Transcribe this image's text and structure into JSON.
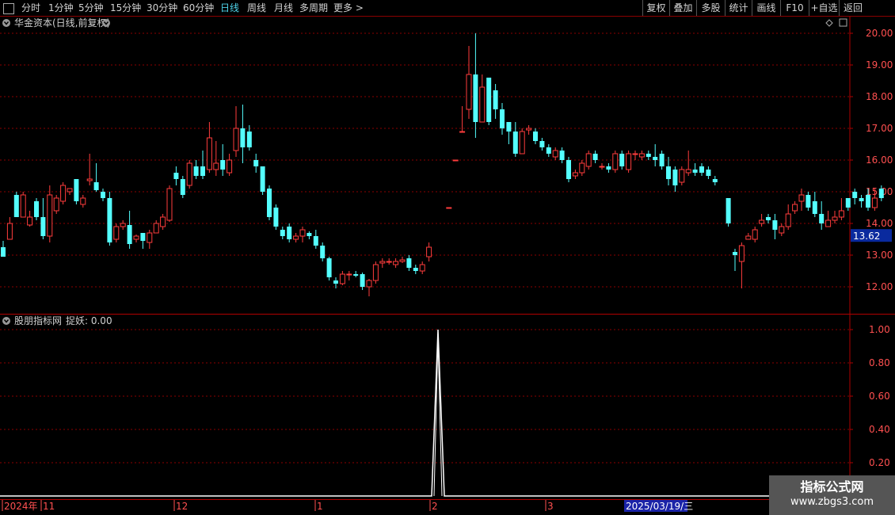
{
  "toolbar": {
    "left_items": [
      "分时",
      "1分钟",
      "5分钟",
      "15分钟",
      "30分钟",
      "60分钟",
      "日线",
      "周线",
      "月线",
      "多周期",
      "更多 >"
    ],
    "active": "日线",
    "right_items": [
      "复权",
      "叠加",
      "多股",
      "统计",
      "画线",
      "F10",
      "+自选",
      "返回"
    ]
  },
  "main_panel": {
    "title": "华金资本(日线,前复权)",
    "y_labels": [
      "20.00",
      "19.00",
      "18.00",
      "17.00",
      "16.00",
      "15.00",
      "14.00",
      "13.00",
      "12.00"
    ],
    "current_price": "13.62"
  },
  "indicator_panel": {
    "title": "股朋指标网",
    "indicator_label": "捉妖: 0.00",
    "y_labels": [
      "1.00",
      "0.80",
      "0.60",
      "0.40",
      "0.20"
    ],
    "spike": {
      "x_date": "2025-02",
      "value": 1.0
    }
  },
  "time_axis": {
    "labels": [
      "2024年",
      "11",
      "12",
      "1",
      "2",
      "3"
    ],
    "cursor_date": "2025/03/19/三"
  },
  "watermark": {
    "title": "指标公式网",
    "url": "www.zbgs3.com"
  },
  "colors": {
    "up": "#ff3d3d",
    "down": "#54ffff",
    "grid": "#8b0000",
    "axis_text": "#ff5050",
    "indicator_line": "#ffffff"
  },
  "chart_data": {
    "type": "candlestick",
    "ylim": [
      11.6,
      20.1
    ],
    "candles": [
      [
        13.25,
        12.95,
        13.45,
        12.95
      ],
      [
        13.5,
        14.0,
        13.6,
        14.2
      ],
      [
        14.9,
        14.2,
        14.3,
        15.0
      ],
      [
        14.2,
        14.9,
        14.2,
        15.0
      ],
      [
        13.95,
        14.2,
        13.9,
        14.4
      ],
      [
        14.7,
        14.2,
        14.1,
        14.8
      ],
      [
        14.2,
        13.6,
        13.5,
        14.8
      ],
      [
        13.6,
        14.9,
        13.4,
        15.2
      ],
      [
        14.4,
        14.8,
        14.3,
        14.9
      ],
      [
        14.7,
        15.2,
        14.6,
        15.3
      ],
      [
        15.0,
        15.1,
        14.9,
        15.1
      ],
      [
        15.4,
        14.7,
        14.6,
        15.4
      ],
      [
        14.6,
        14.8,
        14.5,
        14.9
      ],
      [
        15.35,
        15.4,
        15.2,
        16.2
      ],
      [
        15.3,
        15.05,
        15.0,
        15.9
      ],
      [
        15.0,
        14.8,
        14.7,
        15.1
      ],
      [
        14.8,
        13.4,
        13.3,
        15.0
      ],
      [
        13.5,
        13.9,
        13.4,
        14.0
      ],
      [
        13.9,
        14.0,
        13.8,
        14.1
      ],
      [
        13.95,
        13.35,
        13.2,
        14.4
      ],
      [
        13.5,
        13.6,
        13.4,
        13.65
      ],
      [
        13.7,
        13.45,
        13.2,
        13.7
      ],
      [
        13.4,
        13.7,
        13.2,
        13.8
      ],
      [
        13.7,
        14.0,
        13.7,
        14.1
      ],
      [
        13.9,
        14.2,
        13.8,
        14.3
      ],
      [
        14.1,
        15.1,
        14.05,
        15.2
      ],
      [
        15.6,
        15.4,
        15.2,
        15.8
      ],
      [
        15.4,
        14.9,
        14.8,
        15.5
      ],
      [
        15.2,
        15.9,
        15.1,
        16.0
      ],
      [
        15.8,
        15.5,
        15.4,
        16.0
      ],
      [
        15.8,
        15.5,
        15.4,
        16.3
      ],
      [
        15.7,
        16.7,
        15.6,
        17.2
      ],
      [
        15.7,
        15.9,
        15.5,
        16.6
      ],
      [
        16.0,
        15.7,
        15.5,
        16.5
      ],
      [
        15.6,
        16.0,
        15.5,
        16.2
      ],
      [
        16.3,
        17.0,
        16.1,
        17.7
      ],
      [
        17.0,
        16.4,
        15.9,
        17.75
      ],
      [
        16.9,
        16.4,
        16.3,
        17.1
      ],
      [
        16.0,
        15.8,
        15.6,
        16.2
      ],
      [
        15.8,
        15.0,
        14.9,
        15.8
      ],
      [
        15.1,
        14.2,
        14.1,
        15.2
      ],
      [
        14.5,
        13.9,
        13.8,
        14.6
      ],
      [
        13.8,
        13.6,
        13.5,
        13.9
      ],
      [
        13.9,
        13.5,
        13.4,
        14.0
      ],
      [
        13.5,
        13.6,
        13.4,
        13.7
      ],
      [
        13.6,
        13.8,
        13.4,
        13.9
      ],
      [
        13.7,
        13.6,
        13.5,
        13.75
      ],
      [
        13.6,
        13.3,
        13.2,
        13.8
      ],
      [
        13.3,
        12.9,
        12.8,
        13.4
      ],
      [
        12.9,
        12.3,
        12.2,
        12.95
      ],
      [
        12.2,
        12.1,
        11.95,
        12.3
      ],
      [
        12.1,
        12.4,
        12.05,
        12.5
      ],
      [
        12.4,
        12.4,
        12.2,
        12.5
      ],
      [
        12.4,
        12.35,
        12.3,
        12.5
      ],
      [
        12.4,
        12.0,
        11.9,
        12.45
      ],
      [
        12.0,
        12.2,
        11.7,
        12.25
      ],
      [
        12.2,
        12.7,
        12.1,
        12.8
      ],
      [
        12.75,
        12.8,
        12.6,
        12.9
      ],
      [
        12.8,
        12.8,
        12.7,
        12.9
      ],
      [
        12.7,
        12.8,
        12.6,
        12.9
      ],
      [
        12.8,
        12.85,
        12.75,
        12.95
      ],
      [
        12.9,
        12.6,
        12.5,
        13.0
      ],
      [
        12.6,
        12.5,
        12.4,
        12.7
      ],
      [
        12.5,
        12.7,
        12.4,
        12.8
      ],
      [
        12.95,
        13.25,
        12.8,
        13.4
      ],
      [
        null,
        null,
        null,
        null
      ],
      [
        null,
        null,
        null,
        null
      ],
      [
        14.5,
        14.5,
        14.5,
        14.5
      ],
      [
        16.0,
        16.0,
        16.0,
        16.0
      ],
      [
        16.9,
        16.9,
        16.9,
        17.7
      ],
      [
        17.6,
        18.7,
        17.3,
        19.6
      ],
      [
        18.7,
        17.2,
        16.7,
        20.0
      ],
      [
        17.2,
        18.3,
        17.2,
        18.7
      ],
      [
        18.6,
        17.2,
        17.1,
        18.6
      ],
      [
        18.2,
        17.6,
        17.3,
        18.4
      ],
      [
        17.6,
        17.0,
        16.8,
        17.8
      ],
      [
        17.2,
        16.9,
        16.5,
        17.2
      ],
      [
        16.9,
        16.2,
        16.1,
        17.2
      ],
      [
        16.2,
        16.9,
        16.2,
        17.0
      ],
      [
        16.95,
        17.0,
        16.8,
        17.1
      ],
      [
        16.9,
        16.6,
        16.5,
        17.0
      ],
      [
        16.6,
        16.4,
        16.3,
        16.7
      ],
      [
        16.4,
        16.2,
        16.1,
        16.5
      ],
      [
        16.1,
        16.3,
        16.0,
        16.4
      ],
      [
        16.3,
        16.0,
        15.9,
        16.4
      ],
      [
        16.0,
        15.4,
        15.3,
        16.1
      ],
      [
        15.5,
        15.6,
        15.4,
        15.7
      ],
      [
        15.6,
        15.9,
        15.5,
        16.0
      ],
      [
        15.8,
        16.2,
        15.7,
        16.3
      ],
      [
        16.2,
        16.0,
        15.9,
        16.3
      ],
      [
        15.8,
        15.8,
        15.7,
        15.9
      ],
      [
        15.8,
        15.7,
        15.6,
        15.9
      ],
      [
        15.7,
        16.2,
        15.6,
        16.3
      ],
      [
        16.2,
        15.8,
        15.7,
        16.3
      ],
      [
        15.7,
        16.2,
        15.6,
        16.3
      ],
      [
        16.2,
        16.2,
        16.0,
        16.3
      ],
      [
        16.1,
        16.2,
        16.0,
        16.3
      ],
      [
        16.2,
        16.1,
        16.0,
        16.3
      ],
      [
        16.1,
        16.0,
        15.8,
        16.5
      ],
      [
        16.2,
        15.8,
        15.7,
        16.3
      ],
      [
        15.8,
        15.4,
        15.2,
        16.1
      ],
      [
        15.7,
        15.2,
        15.0,
        15.8
      ],
      [
        15.3,
        15.7,
        15.2,
        15.8
      ],
      [
        15.6,
        15.7,
        15.5,
        16.3
      ],
      [
        15.7,
        15.6,
        15.5,
        15.9
      ],
      [
        15.8,
        15.6,
        15.5,
        15.9
      ],
      [
        15.7,
        15.5,
        15.4,
        15.8
      ],
      [
        15.4,
        15.3,
        15.2,
        15.5
      ],
      [
        null,
        null,
        null,
        null
      ],
      [
        14.8,
        14.0,
        13.9,
        14.8
      ],
      [
        13.1,
        13.0,
        12.5,
        13.2
      ],
      [
        12.8,
        13.3,
        11.95,
        13.4
      ],
      [
        13.5,
        13.6,
        13.5,
        13.7
      ],
      [
        13.5,
        13.8,
        13.4,
        13.9
      ],
      [
        14.0,
        14.1,
        13.9,
        14.3
      ],
      [
        14.2,
        14.1,
        14.0,
        14.3
      ],
      [
        14.1,
        13.8,
        13.5,
        14.3
      ],
      [
        13.7,
        13.9,
        13.6,
        14.0
      ],
      [
        13.9,
        14.3,
        13.8,
        14.6
      ],
      [
        14.4,
        14.6,
        14.3,
        14.7
      ],
      [
        14.7,
        14.9,
        14.4,
        15.1
      ],
      [
        14.9,
        14.5,
        14.4,
        15.0
      ],
      [
        14.7,
        14.3,
        14.2,
        15.0
      ],
      [
        14.3,
        14.0,
        13.8,
        14.7
      ],
      [
        13.9,
        14.1,
        13.9,
        14.4
      ],
      [
        14.1,
        14.2,
        14.0,
        14.4
      ],
      [
        14.2,
        14.4,
        14.1,
        14.8
      ],
      [
        14.8,
        14.5,
        14.4,
        14.8
      ],
      [
        15.0,
        14.8,
        14.6,
        15.1
      ],
      [
        14.8,
        14.7,
        14.5,
        14.9
      ],
      [
        14.9,
        14.5,
        14.4,
        15.1
      ],
      [
        14.5,
        14.8,
        14.4,
        15.1
      ],
      [
        15.1,
        14.8,
        14.7,
        15.2
      ]
    ]
  }
}
